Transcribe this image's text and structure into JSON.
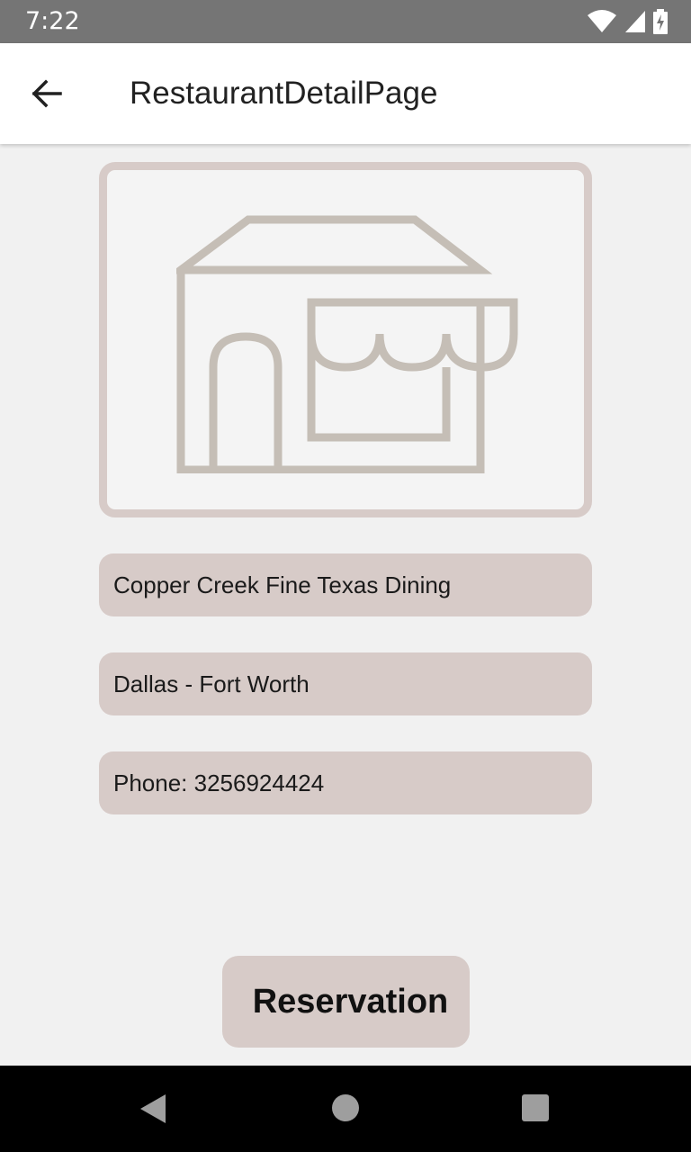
{
  "status_bar": {
    "time": "7:22",
    "icons": [
      "wifi-icon",
      "cell-signal-icon",
      "battery-charging-icon"
    ]
  },
  "app_bar": {
    "back_icon": "arrow-left-icon",
    "title": "RestaurantDetailPage"
  },
  "restaurant": {
    "image_icon": "storefront-icon",
    "name": "Copper Creek Fine Texas Dining",
    "location": "Dallas - Fort Worth",
    "phone": "Phone: 3256924424"
  },
  "actions": {
    "reservation_label": "Reservation"
  },
  "nav_bar": {
    "icons": [
      "nav-back-icon",
      "nav-home-icon",
      "nav-recents-icon"
    ]
  },
  "colors": {
    "accent": "#d7cbc8",
    "status_bar": "#757575",
    "icon_stroke": "#c5beb6",
    "background": "#f1f1f1"
  }
}
